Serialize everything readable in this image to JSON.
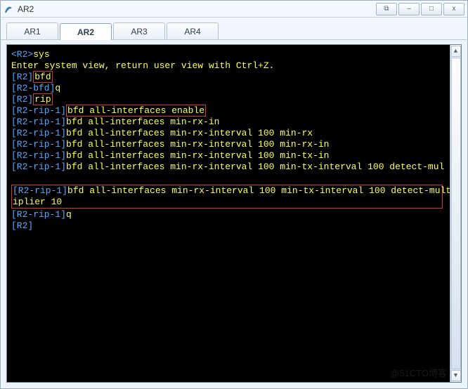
{
  "window": {
    "title": "AR2",
    "buttons": {
      "popout": "⧉",
      "minimize": "–",
      "maximize": "□",
      "close": "x"
    }
  },
  "tabs": [
    {
      "label": "AR1",
      "active": false
    },
    {
      "label": "AR2",
      "active": true
    },
    {
      "label": "AR3",
      "active": false
    },
    {
      "label": "AR4",
      "active": false
    }
  ],
  "term": {
    "l1_prompt": "<R2>",
    "l1_cmd": "sys",
    "l2": "Enter system view, return user view with Ctrl+Z.",
    "l3_prompt": "[R2]",
    "l3_box": "bfd",
    "l4_prompt": "[R2-bfd]",
    "l4_cmd": "q",
    "l5_prompt": "[R2]",
    "l5_box": "rip",
    "l6_prompt": "[R2-rip-1]",
    "l6_box": "bfd all-interfaces enable",
    "l7_prompt": "[R2-rip-1]",
    "l7_cmd": "bfd all-interfaces min-rx-in",
    "l8_prompt": "[R2-rip-1]",
    "l8_cmd": "bfd all-interfaces min-rx-interval 100 min-rx",
    "l9_prompt": "[R2-rip-1]",
    "l9_cmd": "bfd all-interfaces min-rx-interval 100 min-rx-in",
    "l10_prompt": "[R2-rip-1]",
    "l10_cmd": "bfd all-interfaces min-rx-interval 100 min-tx-in",
    "l11_prompt": "[R2-rip-1]",
    "l11_cmd": "bfd all-interfaces min-rx-interval 100 min-tx-interval 100 detect-mul",
    "box_a": "[R2-rip-1]bfd all-interfaces min-rx-interval 100 min-tx-interval 100 detect-mult",
    "box_b": "iplier 10",
    "l14_prompt": "[R2-rip-1]",
    "l14_cmd": "q",
    "l15_prompt": "[R2]"
  },
  "watermark": "@51CTO博客"
}
